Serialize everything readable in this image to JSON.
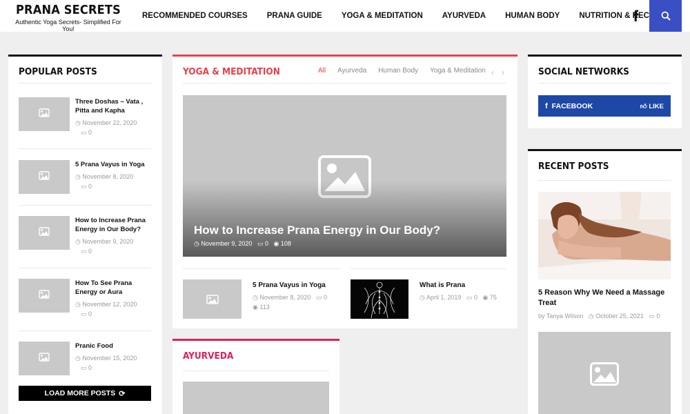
{
  "header": {
    "site_title": "PRANA SECRETS",
    "tagline": "Authentic Yoga Secrets- Simplified For You!",
    "nav": [
      "RECOMMENDED COURSES",
      "PRANA GUIDE",
      "YOGA & MEDITATION",
      "AYURVEDA",
      "HUMAN BODY",
      "NUTRITION & RECIPES"
    ],
    "icons": {
      "facebook": "facebook-icon",
      "search": "search-icon"
    }
  },
  "popular_posts": {
    "title": "POPULAR POSTS",
    "items": [
      {
        "title": "Three Doshas – Vata , Pitta and Kapha",
        "date": "November 22, 2020",
        "comments": "0"
      },
      {
        "title": "5 Prana Vayus in Yoga",
        "date": "November 8, 2020",
        "comments": "0"
      },
      {
        "title": "How to Increase Prana Energy in Our Body?",
        "date": "November 9, 2020",
        "comments": "0"
      },
      {
        "title": "How To See Prana Energy or Aura",
        "date": "November 12, 2020",
        "comments": "0"
      },
      {
        "title": "Pranic Food",
        "date": "November 15, 2020",
        "comments": "0"
      }
    ],
    "load_more": "LOAD MORE POSTS"
  },
  "yoga_section": {
    "title": "YOGA & MEDITATION",
    "tabs": [
      "All",
      "Ayurveda",
      "Human Body",
      "Yoga & Meditation"
    ],
    "active_tab": "All",
    "featured": {
      "title": "How to Increase Prana Energy in Our Body?",
      "date": "November 9, 2020",
      "comments": "0",
      "views": "108"
    },
    "posts": [
      {
        "title": "5 Prana Vayus in Yoga",
        "date": "November 8, 2020",
        "comments": "0",
        "views": "113"
      },
      {
        "title": "What is Prana",
        "date": "April 1, 2019",
        "comments": "0",
        "views": "75"
      }
    ]
  },
  "ayurveda_section": {
    "title": "AYURVEDA"
  },
  "social": {
    "title": "SOCIAL NETWORKS",
    "facebook_label": "FACEBOOK",
    "like_label": "LIKE"
  },
  "recent_posts": {
    "title": "RECENT POSTS",
    "items": [
      {
        "title": "5 Reason Why We Need a Massage Treat",
        "author": "by Tanya Wilson",
        "date": "October 25, 2021",
        "comments": "0"
      }
    ]
  },
  "colors": {
    "accent_red": "#e8404a",
    "accent_pink": "#e0205a",
    "facebook_blue": "#1e48a7",
    "search_blue": "#3a4fc4"
  }
}
